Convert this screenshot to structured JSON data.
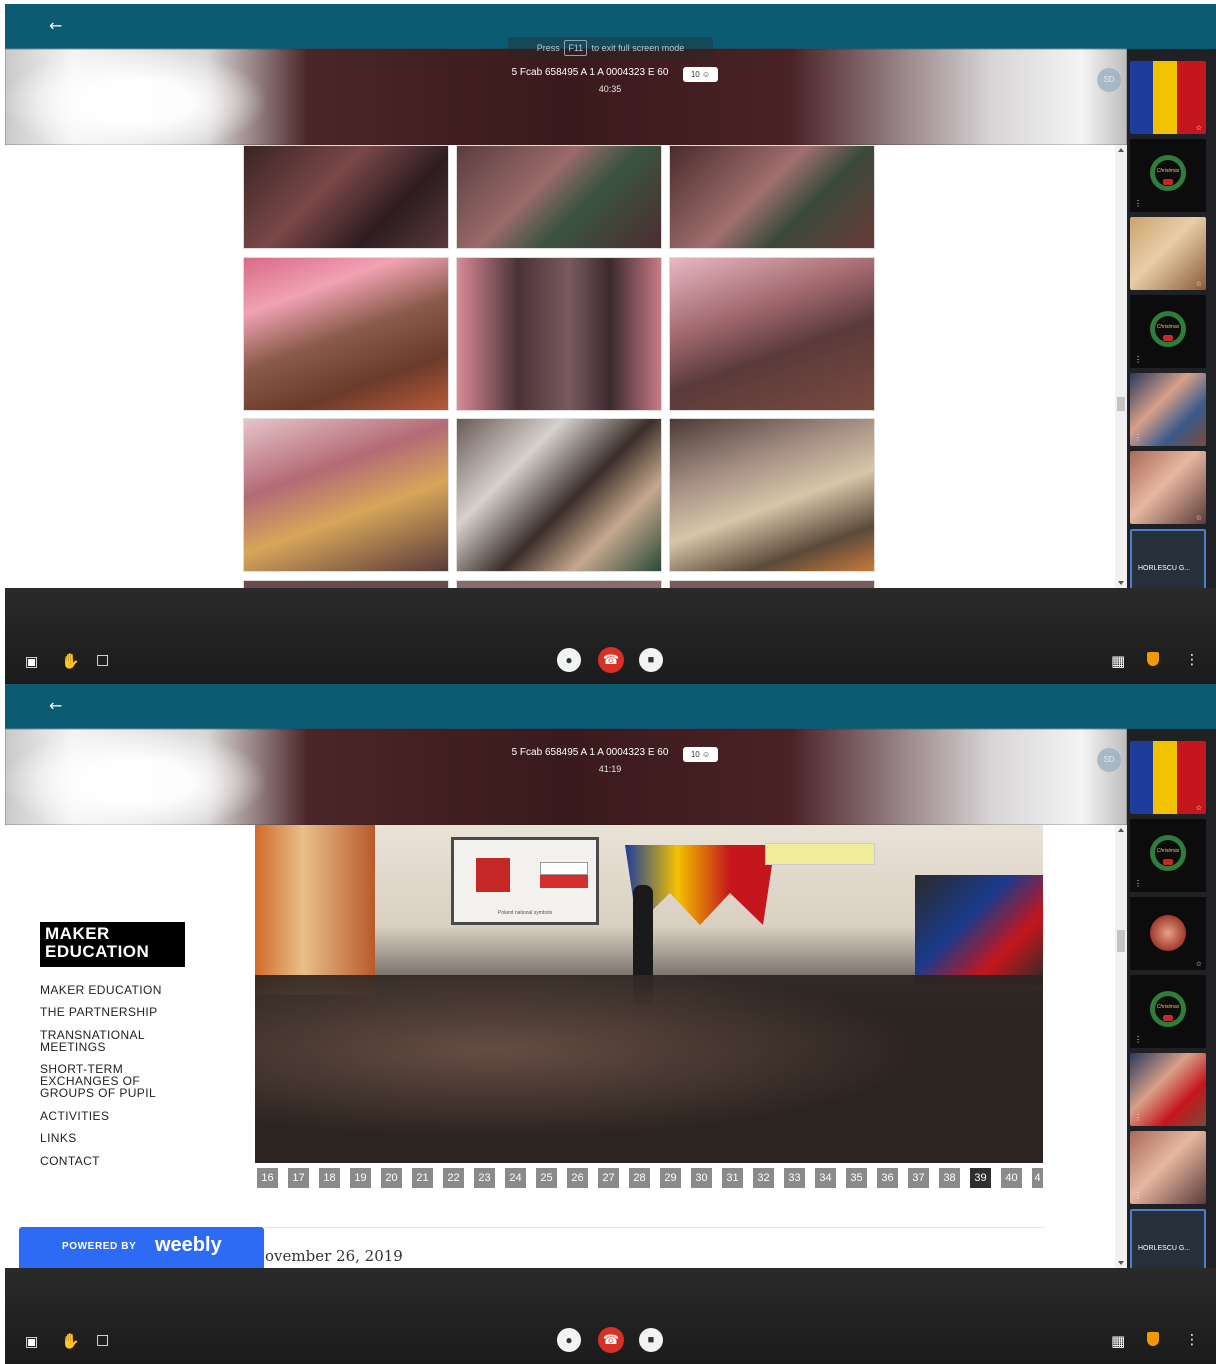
{
  "frames": [
    {
      "back_icon": "arrow-left-icon",
      "fullscreen_hint": {
        "prefix": "Press",
        "key": "F11",
        "suffix": "to exit full screen mode"
      },
      "meeting_code": "5 Fcab 658495 A 1 A 0004323 E 60",
      "participant_count": "10",
      "timer": "40:35",
      "self_badge": "SD",
      "tile_name": "HORLESCU G...",
      "wreath_text": "Christmas"
    },
    {
      "back_icon": "arrow-left-icon",
      "meeting_code": "5 Fcab 658495 A 1 A 0004323 E 60",
      "participant_count": "10",
      "timer": "41:19",
      "self_badge": "SD",
      "tile_name": "HORLESCU G...",
      "wreath_text": "Christmas",
      "site": {
        "logo_line1": "MAKER",
        "logo_line2": "EDUCATION",
        "nav": [
          "MAKER EDUCATION",
          "THE PARTNERSHIP",
          "TRANSNATIONAL MEETINGS",
          "SHORT-TERM EXCHANGES OF GROUPS OF PUPIL",
          "ACTIVITIES",
          "LINKS",
          "CONTACT"
        ],
        "pager": [
          "16",
          "17",
          "18",
          "19",
          "20",
          "21",
          "22",
          "23",
          "24",
          "25",
          "26",
          "27",
          "28",
          "29",
          "30",
          "31",
          "32",
          "33",
          "34",
          "35",
          "36",
          "37",
          "38",
          "39",
          "40",
          "4"
        ],
        "pager_active": "39",
        "slide_caption": "Poland national symbols",
        "post_date": "ovember 26, 2019",
        "powered_by": "POWERED BY",
        "weebly": "weebly"
      }
    }
  ],
  "icons": {
    "present": "present-screen-icon",
    "hand": "raise-hand-icon",
    "chat": "chat-icon",
    "mic": "microphone-icon",
    "end": "end-call-icon",
    "camera": "camera-icon",
    "grid": "grid-layout-icon",
    "shield": "shield-icon",
    "more": "more-vertical-icon"
  },
  "colors": {
    "topbar": "#0b5b73",
    "end_call": "#d93025",
    "weebly_blue": "#2d6bf4",
    "active_page": "#2f2f2f"
  }
}
